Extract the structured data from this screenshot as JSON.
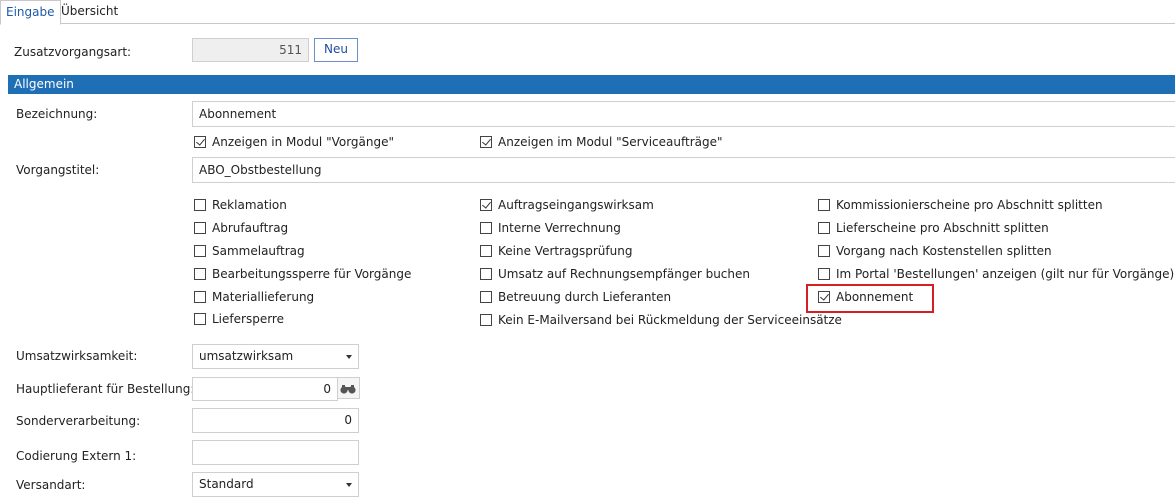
{
  "tabs": [
    {
      "label": "Eingabe",
      "active": true
    },
    {
      "label": "Übersicht",
      "active": false
    }
  ],
  "header": {
    "zusatz_label": "Zusatzvorgangsart:",
    "zusatz_value": "511",
    "neu_button": "Neu"
  },
  "section_title": "Allgemein",
  "bezeichnung": {
    "label": "Bezeichnung:",
    "value": "Abonnement"
  },
  "vorgangstitel": {
    "label": "Vorgangstitel:",
    "value": "ABO_Obstbestellung"
  },
  "top_checks": [
    {
      "label": "Anzeigen in Modul \"Vorgänge\"",
      "checked": true
    },
    {
      "label": "Anzeigen im Modul \"Serviceaufträge\"",
      "checked": true
    }
  ],
  "checks_col1": [
    {
      "label": "Reklamation",
      "checked": false
    },
    {
      "label": "Abrufauftrag",
      "checked": false
    },
    {
      "label": "Sammelauftrag",
      "checked": false
    },
    {
      "label": "Bearbeitungssperre für Vorgänge",
      "checked": false
    },
    {
      "label": "Materiallieferung",
      "checked": false
    },
    {
      "label": "Liefersperre",
      "checked": false
    }
  ],
  "checks_col2": [
    {
      "label": "Auftragseingangswirksam",
      "checked": true
    },
    {
      "label": "Interne Verrechnung",
      "checked": false
    },
    {
      "label": "Keine Vertragsprüfung",
      "checked": false
    },
    {
      "label": "Umsatz auf Rechnungsempfänger buchen",
      "checked": false
    },
    {
      "label": "Betreuung durch Lieferanten",
      "checked": false
    },
    {
      "label": "Kein E-Mailversand bei Rückmeldung der Serviceeinsätze",
      "checked": false
    }
  ],
  "checks_col3": [
    {
      "label": "Kommissionierscheine pro Abschnitt splitten",
      "checked": false
    },
    {
      "label": "Lieferscheine pro Abschnitt splitten",
      "checked": false
    },
    {
      "label": "Vorgang nach Kostenstellen splitten",
      "checked": false
    },
    {
      "label": "Im Portal 'Bestellungen' anzeigen (gilt nur für Vorgänge)",
      "checked": false
    },
    {
      "label": "Abonnement",
      "checked": true
    }
  ],
  "form": {
    "umsatz": {
      "label": "Umsatzwirksamkeit:",
      "value": "umsatzwirksam"
    },
    "hauptlieferant": {
      "label": "Hauptlieferant für Bestellung:",
      "value": "0"
    },
    "sonder": {
      "label": "Sonderverarbeitung:",
      "value": "0"
    },
    "codierung": {
      "label": "Codierung Extern 1:",
      "value": ""
    },
    "versandart": {
      "label": "Versandart:",
      "value": "Standard"
    }
  },
  "colors": {
    "accent": "#1f6fb6",
    "highlight": "#d42020"
  }
}
